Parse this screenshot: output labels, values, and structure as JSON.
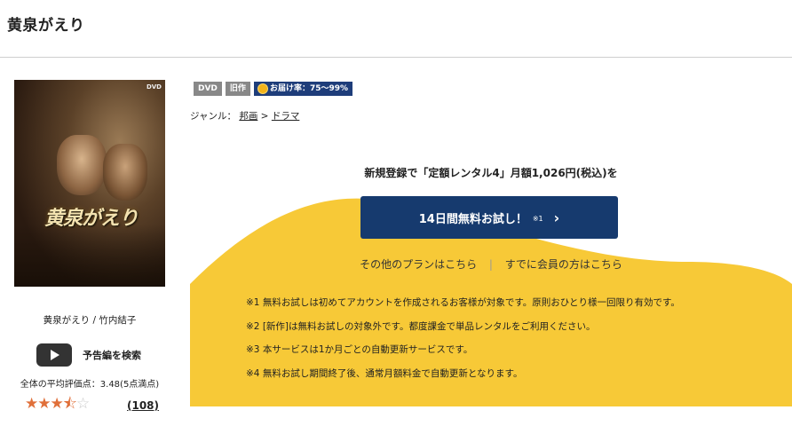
{
  "page": {
    "title": "黄泉がえり"
  },
  "cover": {
    "dvd_mark": "DVD",
    "title_art": "黄泉がえり"
  },
  "item": {
    "caption": "黄泉がえり / 竹内結子",
    "trailer_label": "予告編を検索",
    "rating_text": "全体の平均評価点：3.48(5点満点)",
    "rating_value": 3.5,
    "rating_max": 5,
    "review_count": "(108)"
  },
  "badges": {
    "dvd": "DVD",
    "old": "旧作",
    "delivery": "お届け率：75〜99%"
  },
  "genre": {
    "label": "ジャンル：",
    "path": [
      "邦画",
      "ドラマ"
    ],
    "separator": ">"
  },
  "promo": {
    "headline": "新規登録で「定額レンタル4」月額1,026円(税込)を",
    "cta_label": "14日間無料お試し！",
    "cta_note": "※1",
    "cta_chevron": "›",
    "other_plans": "その他のプランはこちら",
    "separator": "|",
    "member_link": "すでに会員の方はこちら",
    "notes": [
      "※1 無料お試しは初めてアカウントを作成されるお客様が対象です。原則おひとり様一回限り有効です。",
      "※2 [新作]は無料お試しの対象外です。都度課金で単品レンタルをご利用ください。",
      "※3 本サービスは1か月ごとの自動更新サービスです。",
      "※4 無料お試し期間終了後、通常月額料金で自動更新となります。"
    ]
  },
  "colors": {
    "accent": "#163a6e",
    "promo_bg": "#f7c937",
    "star": "#e0703a"
  }
}
